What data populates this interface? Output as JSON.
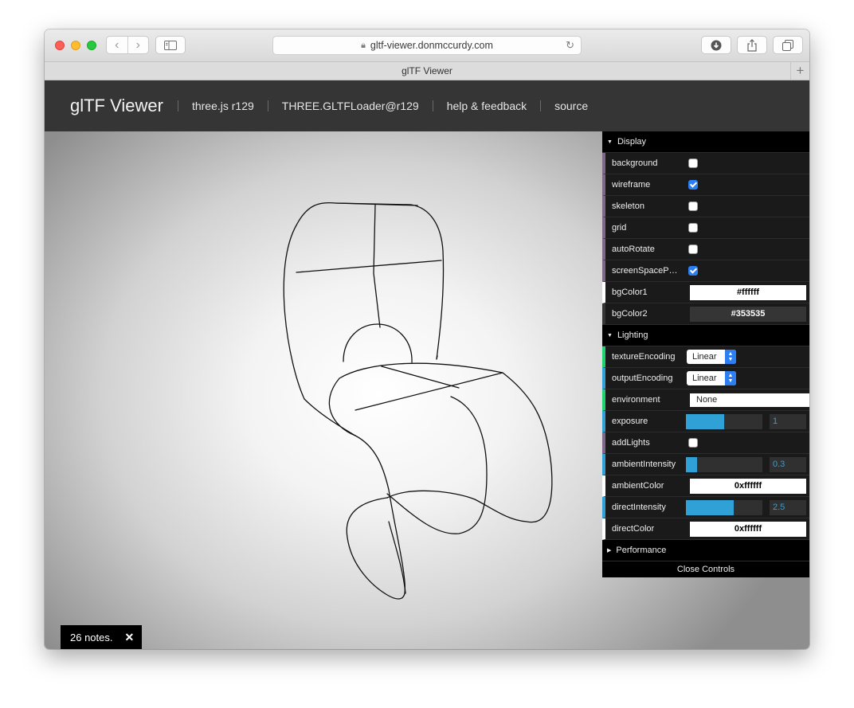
{
  "browser": {
    "url": "gltf-viewer.donmccurdy.com",
    "tab_title": "glTF Viewer",
    "new_tab": "+"
  },
  "header": {
    "brand": "glTF Viewer",
    "links": [
      "three.js r129",
      "THREE.GLTFLoader@r129",
      "help & feedback",
      "source"
    ]
  },
  "panel": {
    "display": {
      "title": "Display",
      "background": {
        "label": "background",
        "checked": false
      },
      "wireframe": {
        "label": "wireframe",
        "checked": true
      },
      "skeleton": {
        "label": "skeleton",
        "checked": false
      },
      "grid": {
        "label": "grid",
        "checked": false
      },
      "autoRotate": {
        "label": "autoRotate",
        "checked": false
      },
      "screenSpacePanning": {
        "label": "screenSpacePan…",
        "checked": true
      },
      "bgColor1": {
        "label": "bgColor1",
        "value": "#ffffff"
      },
      "bgColor2": {
        "label": "bgColor2",
        "value": "#353535"
      }
    },
    "lighting": {
      "title": "Lighting",
      "textureEncoding": {
        "label": "textureEncoding",
        "value": "Linear"
      },
      "outputEncoding": {
        "label": "outputEncoding",
        "value": "Linear"
      },
      "environment": {
        "label": "environment",
        "value": "None"
      },
      "exposure": {
        "label": "exposure",
        "value": "1",
        "fraction": 0.5
      },
      "addLights": {
        "label": "addLights",
        "checked": false
      },
      "ambientIntensity": {
        "label": "ambientIntensity",
        "value": "0.3",
        "fraction": 0.15
      },
      "ambientColor": {
        "label": "ambientColor",
        "value": "0xffffff"
      },
      "directIntensity": {
        "label": "directIntensity",
        "value": "2.5",
        "fraction": 0.625
      },
      "directColor": {
        "label": "directColor",
        "value": "0xffffff"
      }
    },
    "performance": {
      "title": "Performance"
    },
    "close_label": "Close Controls"
  },
  "notes": {
    "label": "26 notes.",
    "close": "✕"
  },
  "colors": {
    "accent": "#2c7ef2",
    "slider": "#2fa1d6",
    "header_bg": "#353535"
  }
}
